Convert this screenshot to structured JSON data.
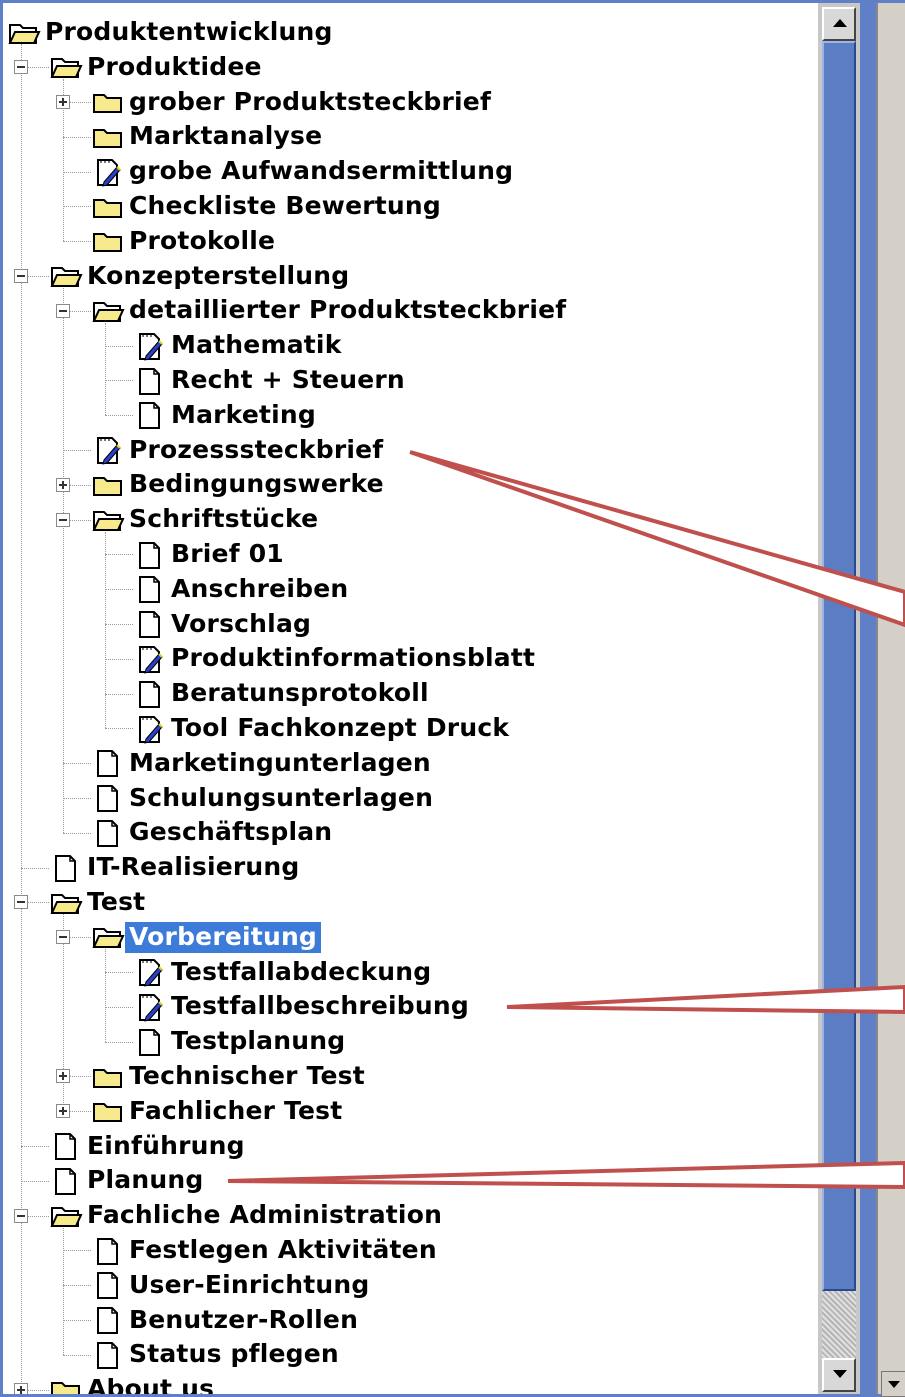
{
  "tree": {
    "nodes": [
      {
        "label": "Produktentwicklung",
        "type": "folder-open"
      },
      {
        "label": "Produktidee",
        "type": "folder-open"
      },
      {
        "label": "grober Produktsteckbrief",
        "type": "folder"
      },
      {
        "label": "Marktanalyse",
        "type": "folder"
      },
      {
        "label": "grobe Aufwandsermittlung",
        "type": "doc-edit"
      },
      {
        "label": "Checkliste Bewertung",
        "type": "folder"
      },
      {
        "label": "Protokolle",
        "type": "folder"
      },
      {
        "label": "Konzepterstellung",
        "type": "folder-open"
      },
      {
        "label": "detaillierter Produktsteckbrief",
        "type": "folder-open"
      },
      {
        "label": "Mathematik",
        "type": "doc-edit"
      },
      {
        "label": "Recht + Steuern",
        "type": "doc"
      },
      {
        "label": "Marketing",
        "type": "doc"
      },
      {
        "label": "Prozesssteckbrief",
        "type": "doc-edit"
      },
      {
        "label": "Bedingungswerke",
        "type": "folder"
      },
      {
        "label": "Schriftstücke",
        "type": "folder-open"
      },
      {
        "label": "Brief 01",
        "type": "doc"
      },
      {
        "label": "Anschreiben",
        "type": "doc"
      },
      {
        "label": "Vorschlag",
        "type": "doc"
      },
      {
        "label": "Produktinformationsblatt",
        "type": "doc-edit"
      },
      {
        "label": "Beratunsprotokoll",
        "type": "doc"
      },
      {
        "label": "Tool Fachkonzept Druck",
        "type": "doc-edit"
      },
      {
        "label": "Marketingunterlagen",
        "type": "doc"
      },
      {
        "label": "Schulungsunterlagen",
        "type": "doc"
      },
      {
        "label": "Geschäftsplan",
        "type": "doc"
      },
      {
        "label": "IT-Realisierung",
        "type": "doc"
      },
      {
        "label": "Test",
        "type": "folder-open"
      },
      {
        "label": "Vorbereitung",
        "type": "folder-open",
        "selected": true
      },
      {
        "label": "Testfallabdeckung",
        "type": "doc-edit"
      },
      {
        "label": "Testfallbeschreibung",
        "type": "doc-edit"
      },
      {
        "label": "Testplanung",
        "type": "doc"
      },
      {
        "label": "Technischer Test",
        "type": "folder"
      },
      {
        "label": "Fachlicher Test",
        "type": "folder"
      },
      {
        "label": "Einführung",
        "type": "doc"
      },
      {
        "label": "Planung",
        "type": "doc"
      },
      {
        "label": "Fachliche Administration",
        "type": "folder-open"
      },
      {
        "label": "Festlegen Aktivitäten",
        "type": "doc"
      },
      {
        "label": "User-Einrichtung",
        "type": "doc"
      },
      {
        "label": "Benutzer-Rollen",
        "type": "doc"
      },
      {
        "label": "Status pflegen",
        "type": "doc"
      },
      {
        "label": "About us",
        "type": "folder"
      }
    ]
  },
  "colors": {
    "selection": "#3c7bd8",
    "folder": "#f6ea8c",
    "annotation_line": "#c0504d",
    "scrollbar": "#5b7dc4"
  },
  "scrollbar": {
    "up_icon": "arrow-up-icon",
    "down_icon": "arrow-down-icon"
  }
}
